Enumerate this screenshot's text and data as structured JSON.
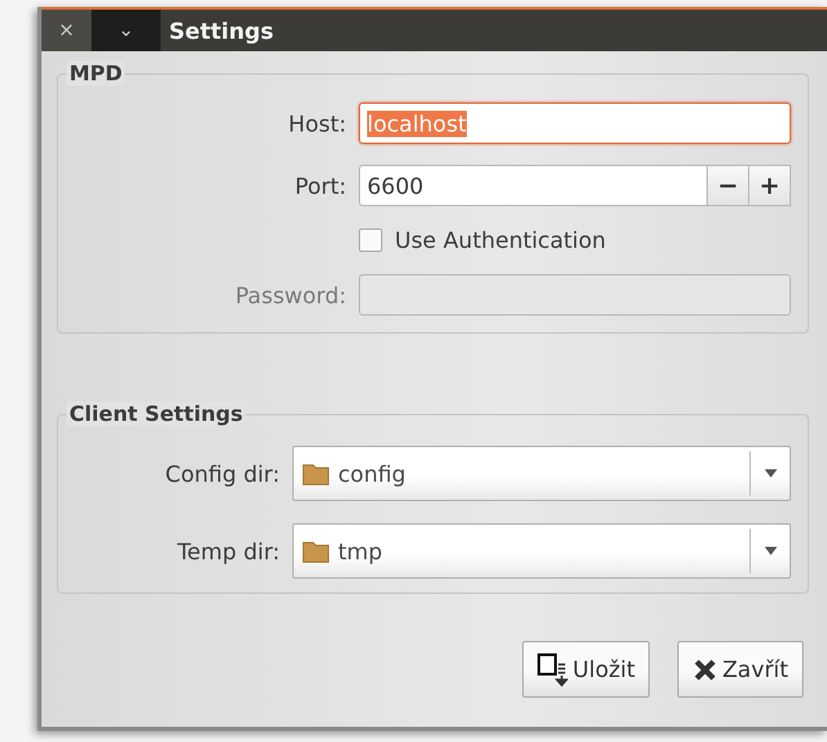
{
  "window": {
    "title": "Settings",
    "close_glyph": "×",
    "menu_glyph": "⌄"
  },
  "mpd": {
    "title": "MPD",
    "host": {
      "label": "Host:",
      "value": "localhost",
      "focused": true
    },
    "port": {
      "label": "Port:",
      "value": "6600",
      "minus": "−",
      "plus": "+"
    },
    "use_auth": {
      "label": "Use Authentication",
      "checked": false
    },
    "password": {
      "label": "Password:",
      "disabled": true
    }
  },
  "client_settings": {
    "title": "Client Settings",
    "dirs": [
      {
        "label": "Config dir:",
        "value": "config"
      },
      {
        "label": "Temp dir:",
        "value": "tmp"
      }
    ]
  },
  "buttons": [
    {
      "kind": "save",
      "label": "Uložit"
    },
    {
      "kind": "close",
      "label": "Zavřít"
    }
  ]
}
